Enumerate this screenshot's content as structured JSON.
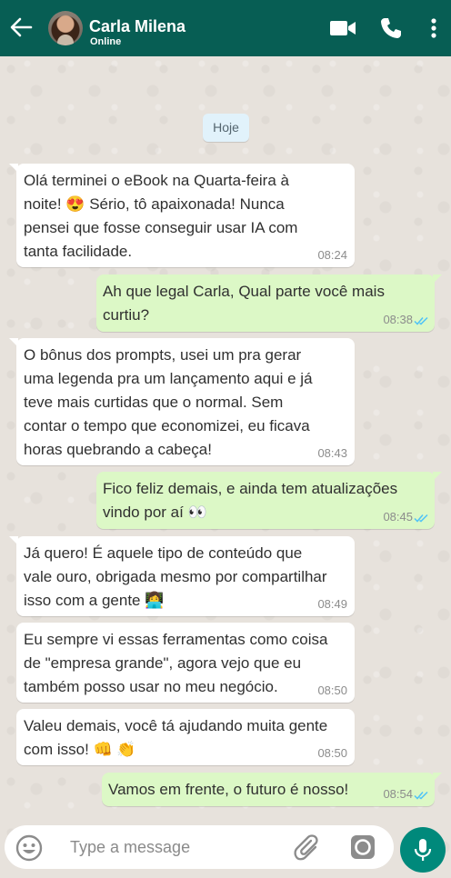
{
  "header": {
    "contact_name": "Carla Milena",
    "status": "Online",
    "back_icon": "arrow-back-icon",
    "video_icon": "video-call-icon",
    "phone_icon": "phone-icon",
    "menu_icon": "more-vert-icon"
  },
  "date_chip": "Hoje",
  "messages": [
    {
      "direction": "in",
      "lines": [
        "Olá terminei o eBook na Quarta-feira à",
        "noite! 😍  Sério, tô apaixonada! Nunca",
        "pensei que fosse conseguir usar IA com",
        "tanta facilidade."
      ],
      "time": "08:24"
    },
    {
      "direction": "out",
      "lines": [
        "Ah que legal Carla, Qual parte você mais",
        "curtiu?"
      ],
      "time": "08:38"
    },
    {
      "direction": "in",
      "lines": [
        "O bônus dos prompts, usei um pra gerar",
        "uma legenda pra um lançamento aqui e já",
        "teve mais curtidas que o normal. Sem",
        "contar o tempo que economizei, eu ficava",
        "horas quebrando a cabeça!"
      ],
      "time": "08:43"
    },
    {
      "direction": "out",
      "lines": [
        "Fico feliz demais, e ainda tem atualizações",
        "vindo por aí 👀"
      ],
      "time": "08:45"
    },
    {
      "direction": "in",
      "lines": [
        "Já quero! É aquele tipo de conteúdo que",
        "vale ouro, obrigada mesmo por compartilhar",
        "isso com a gente 👩‍💻"
      ],
      "time": "08:49"
    },
    {
      "direction": "in",
      "lines": [
        "Eu sempre vi essas ferramentas como coisa",
        "de \"empresa grande\", agora vejo que eu",
        "também posso usar no meu negócio."
      ],
      "time": "08:50"
    },
    {
      "direction": "in",
      "lines": [
        "Valeu demais, você tá ajudando muita gente",
        "com isso! 👊 👏"
      ],
      "time": "08:50"
    },
    {
      "direction": "out",
      "lines": [
        "Vamos em frente, o futuro é nosso!"
      ],
      "time": "08:54"
    }
  ],
  "input": {
    "placeholder": "Type a message",
    "emoji_icon": "emoji-icon",
    "attach_icon": "paperclip-icon",
    "camera_icon": "camera-icon",
    "mic_icon": "mic-icon"
  },
  "colors": {
    "header": "#075e54",
    "incoming_bubble": "#ffffff",
    "outgoing_bubble": "#dcf8c6",
    "read_ticks": "#4fc3f7",
    "mic_button": "#00897b"
  }
}
